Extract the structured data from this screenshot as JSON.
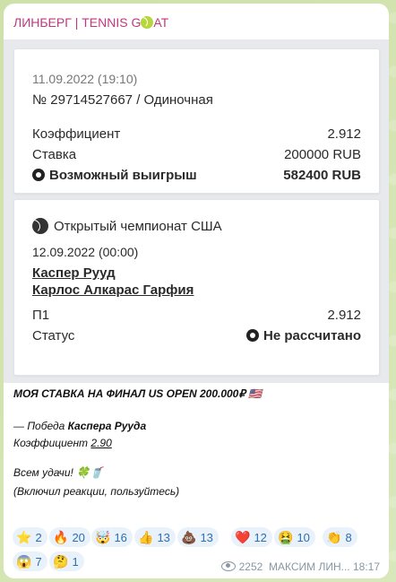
{
  "channel": {
    "name_prefix": "ЛИНБЕРГ | TENNIS G",
    "name_suffix": "AT"
  },
  "bet_card": {
    "datetime": "11.09.2022 (19:10)",
    "number": "№ 29714527667 / Одиночная",
    "coef_label": "Коэффициент",
    "coef_value": "2.912",
    "stake_label": "Ставка",
    "stake_value": "200000 RUB",
    "win_label": "Возможный выигрыш",
    "win_value": "582400 RUB"
  },
  "event_card": {
    "tournament": "Открытый чемпионат США",
    "datetime": "12.09.2022 (00:00)",
    "player1": "Каспер Рууд",
    "player2": "Карлос Алкарас Гарфия",
    "market_label": "П1",
    "market_value": "2.912",
    "status_label": "Статус",
    "status_value": "Не рассчитано"
  },
  "message": {
    "line1": "МОЯ СТАВКА НА ФИНАЛ US OPEN 200.000₽ 🇺🇸",
    "line2_prefix": "— Победа ",
    "line2_bold": "Каспера Рууда",
    "line3_prefix": "Коэффициент ",
    "line3_value": "2.90",
    "line4": "Всем удачи! 🍀🥤",
    "line5": "(Включил реакции, пользуйтесь)"
  },
  "reactions": [
    {
      "emoji": "⭐",
      "count": "2"
    },
    {
      "emoji": "🔥",
      "count": "20"
    },
    {
      "emoji": "🤯",
      "count": "16"
    },
    {
      "emoji": "👍",
      "count": "13"
    },
    {
      "emoji": "💩",
      "count": "13"
    },
    {
      "emoji": "❤️",
      "count": "12"
    },
    {
      "emoji": "🤮",
      "count": "10"
    },
    {
      "emoji": "👏",
      "count": "8"
    },
    {
      "emoji": "😱",
      "count": "7"
    },
    {
      "emoji": "🤔",
      "count": "1"
    }
  ],
  "footer": {
    "views": "2252",
    "author": "МАКСИМ ЛИН...",
    "time": "18:17"
  },
  "colors": {
    "accent": "#c0397d",
    "reaction_bg": "#e9f2fb",
    "reaction_text": "#2b6fb0"
  }
}
